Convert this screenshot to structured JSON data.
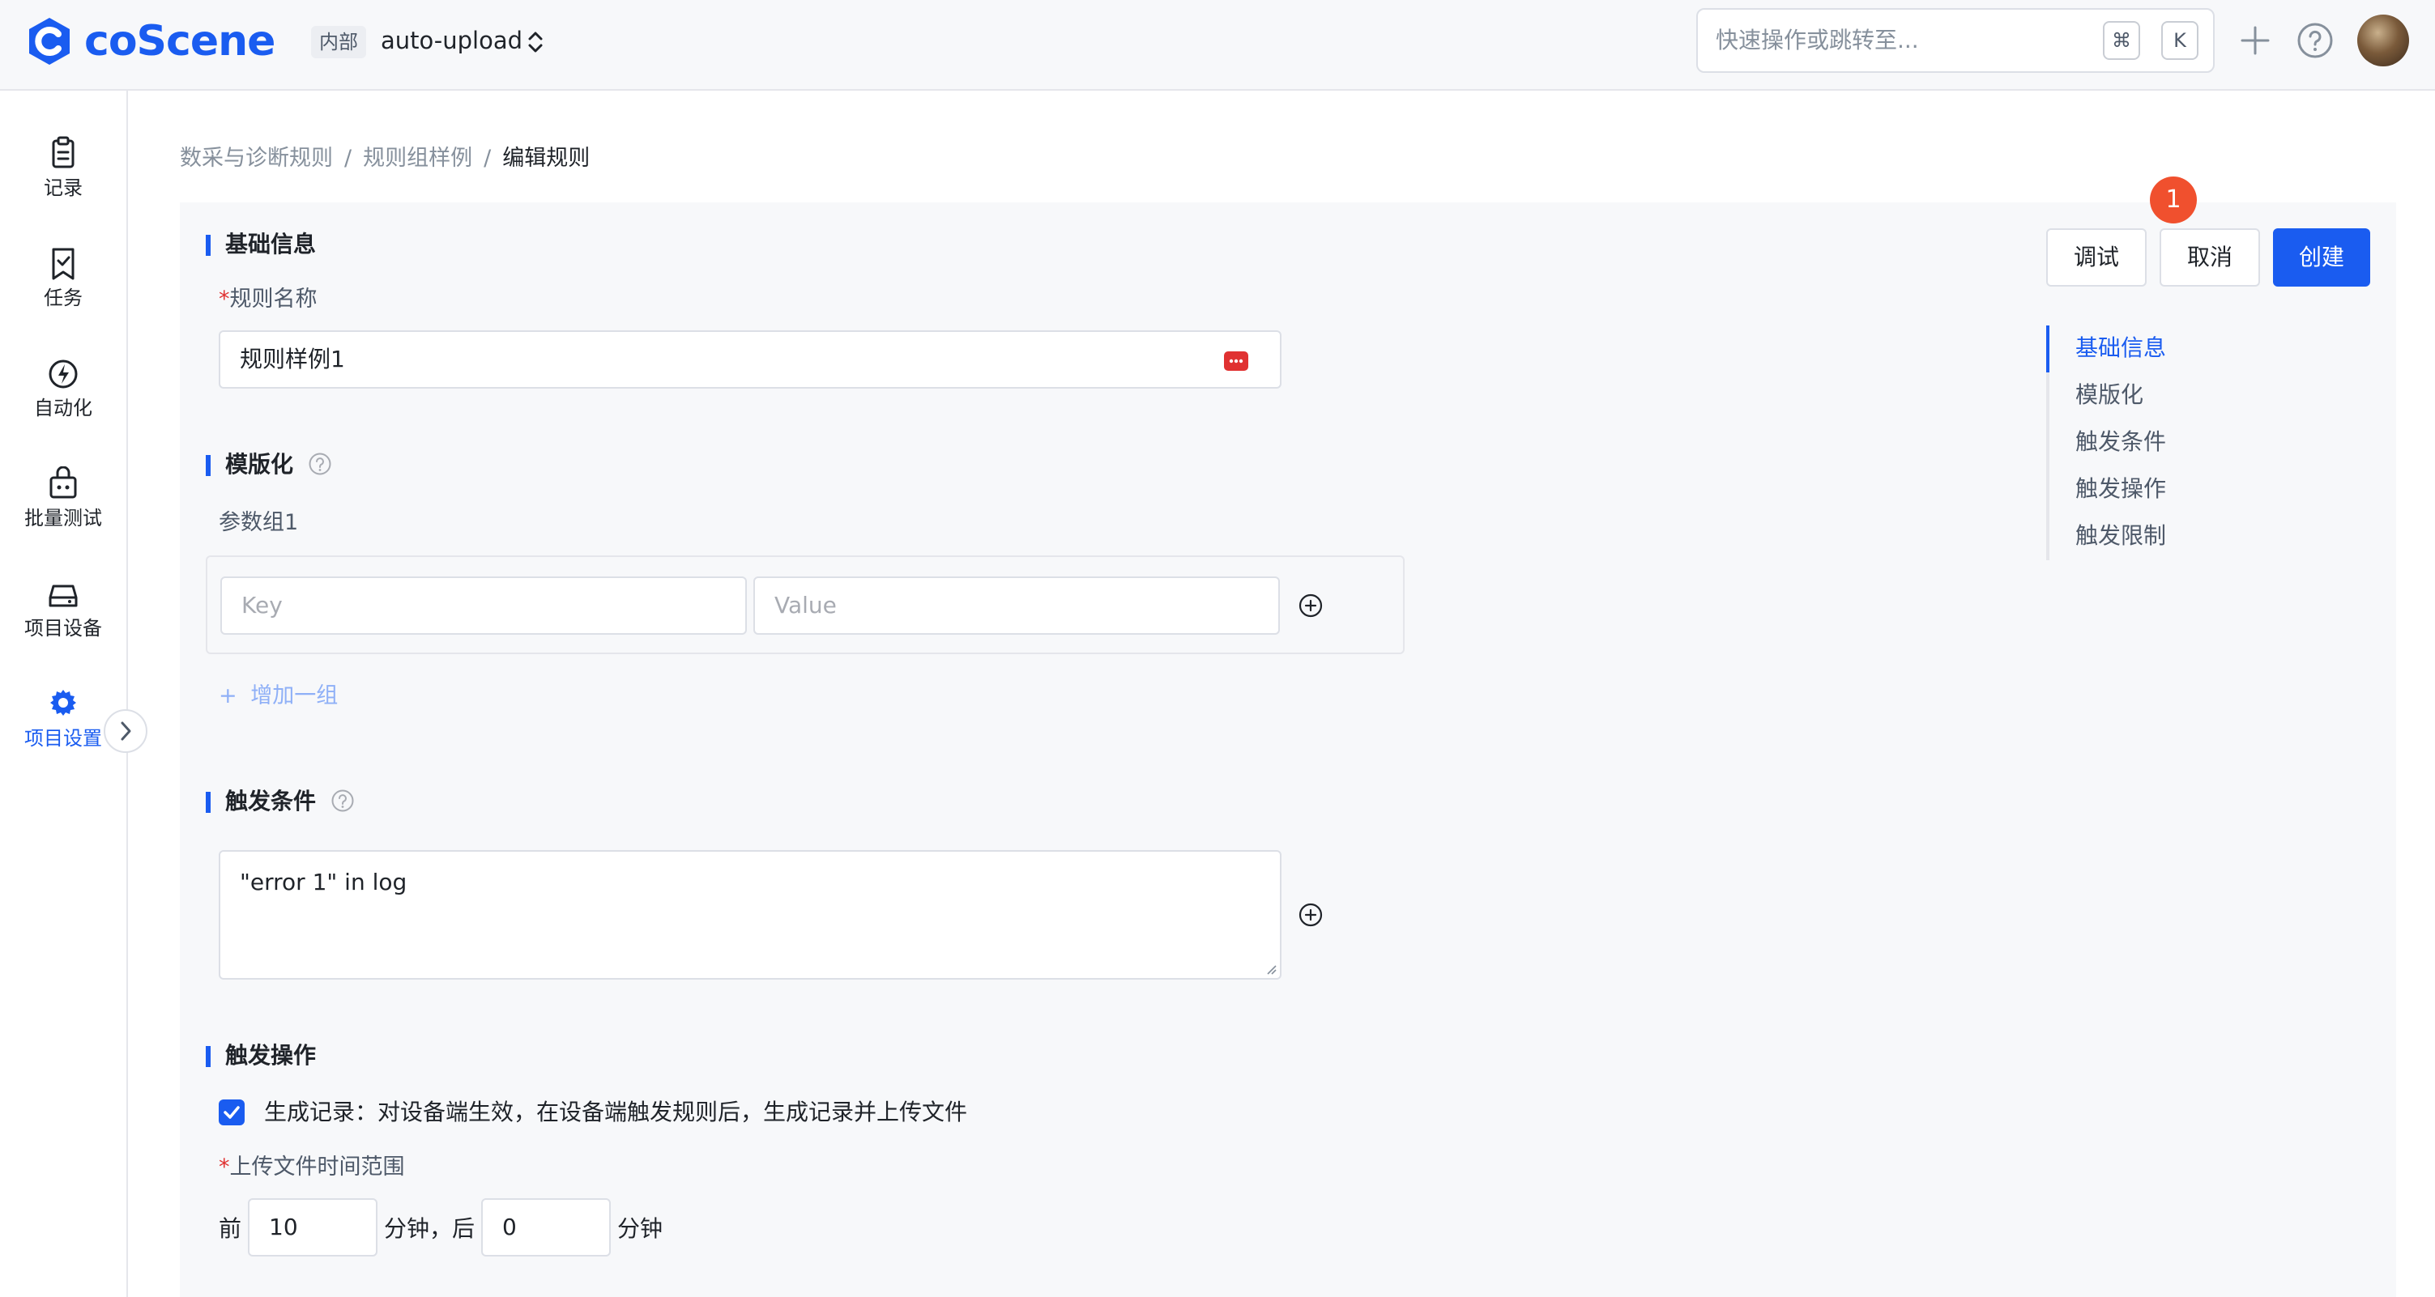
{
  "topbar": {
    "logo_text": "coScene",
    "project_tag": "内部",
    "project_name": "auto-upload",
    "search_placeholder": "快速操作或跳转至...",
    "kbd_cmd": "⌘",
    "kbd_k": "K"
  },
  "sidebar": {
    "items": [
      {
        "label": "记录",
        "icon": "record-icon"
      },
      {
        "label": "任务",
        "icon": "task-icon"
      },
      {
        "label": "自动化",
        "icon": "automation-icon"
      },
      {
        "label": "批量测试",
        "icon": "batch-test-icon"
      },
      {
        "label": "项目设备",
        "icon": "device-icon"
      },
      {
        "label": "项目设置",
        "icon": "settings-icon",
        "active": true
      }
    ]
  },
  "breadcrumb": {
    "items": [
      "数采与诊断规则",
      "规则组样例",
      "编辑规则"
    ],
    "separator": "/"
  },
  "actions": {
    "debug": "调试",
    "cancel": "取消",
    "create": "创建",
    "badge_count": "1"
  },
  "anchors": {
    "items": [
      "基础信息",
      "模版化",
      "触发条件",
      "触发操作",
      "触发限制"
    ],
    "active_index": 0
  },
  "basic": {
    "title": "基础信息",
    "name_label": "规则名称",
    "required_mark": "*",
    "name_value": "规则样例1"
  },
  "template": {
    "title": "模版化",
    "group_label": "参数组1",
    "key_placeholder": "Key",
    "value_placeholder": "Value",
    "add_group": "增加一组",
    "add_group_icon": "+"
  },
  "trigger": {
    "title": "触发条件",
    "condition": "\"error 1\" in log"
  },
  "operation": {
    "title": "触发操作",
    "checkbox_label": "生成记录：对设备端生效，在设备端触发规则后，生成记录并上传文件",
    "checked": true,
    "range_label": "上传文件时间范围",
    "required_mark": "*",
    "before_label": "前",
    "before_value": "10",
    "mid_label": "分钟，后",
    "after_value": "0",
    "after_label": "分钟"
  },
  "colors": {
    "primary": "#1a5cf0",
    "badge": "#f0502e",
    "required": "#e03131"
  }
}
